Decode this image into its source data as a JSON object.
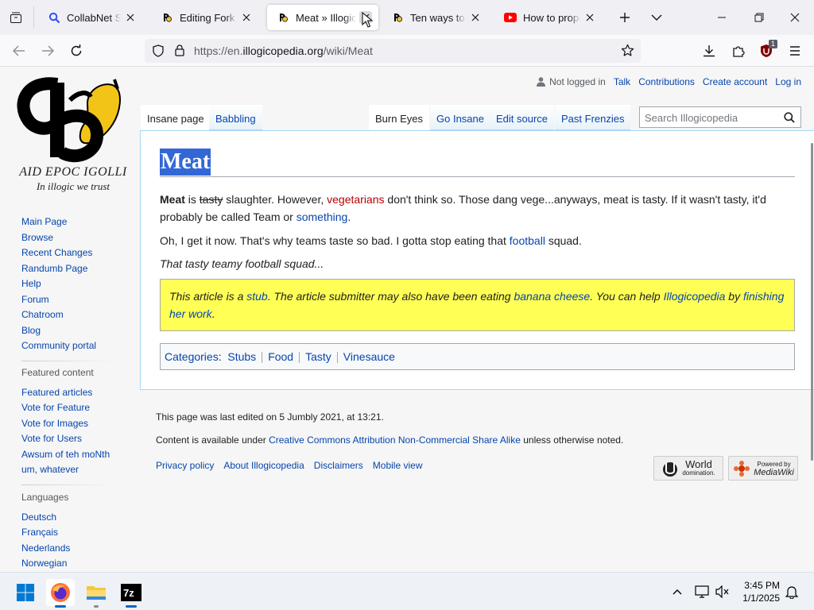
{
  "browser": {
    "tabs": [
      {
        "title": "CollabNet SearX",
        "favicon": "search-icon"
      },
      {
        "title": "Editing Fork » Illogicopedia",
        "favicon": "illogicopedia-icon"
      },
      {
        "title": "Meat » Illogicopedia",
        "favicon": "illogicopedia-icon",
        "active": true
      },
      {
        "title": "Ten ways to kill",
        "favicon": "illogicopedia-icon"
      },
      {
        "title": "How to properly",
        "favicon": "youtube-icon"
      }
    ],
    "url_prefix": "https://en.",
    "url_domain": "illogicopedia.org",
    "url_path": "/wiki/Meat",
    "extension_badge": "1"
  },
  "wiki": {
    "logo_text": "AID EPOC IGOLLI",
    "logo_tagline": "In illogic we trust",
    "personal": {
      "not_logged_in": "Not logged in",
      "talk": "Talk",
      "contributions": "Contributions",
      "create_account": "Create account",
      "log_in": "Log in"
    },
    "tabs": {
      "page": "Insane page",
      "discussion": "Babbling",
      "read": "Burn Eyes",
      "edit": "Go Insane",
      "edit_source": "Edit source",
      "history": "Past Frenzies"
    },
    "search_placeholder": "Search Illogicopedia",
    "nav": [
      "Main Page",
      "Browse",
      "Recent Changes",
      "Randumb Page",
      "Help",
      "Forum",
      "Chatroom",
      "Blog",
      "Community portal"
    ],
    "featured_heading": "Featured content",
    "featured": [
      "Featured articles",
      "Vote for Feature",
      "Vote for Images",
      "Vote for Users",
      "Awsum of teh moNth",
      "um, whatever"
    ],
    "languages_heading": "Languages",
    "languages": [
      "Deutsch",
      "Français",
      "Nederlands",
      "Norwegian"
    ],
    "heading": "Meat",
    "p1": {
      "bold": "Meat",
      "is": " is ",
      "struck": "tasty",
      "t1": " slaughter. However, ",
      "link1": "vegetarians",
      "t2": " don't think so. Those dang vege...anyways, meat is tasty. If it wasn't tasty, it'd probably be called Team or ",
      "link2": "something",
      "t3": "."
    },
    "p2": {
      "t1": "Oh, I get it now. That's why teams taste so bad. I gotta stop eating that ",
      "link": "football",
      "t2": " squad."
    },
    "p3": "That tasty teamy football squad...",
    "stub": {
      "t1": "This article is a ",
      "link1": "stub",
      "t2": ". The article submitter may also have been eating ",
      "link2": "banana cheese",
      "t3": ". You can help ",
      "link3": "Illogicopedia",
      "t4": " by ",
      "link4": "finishing her work",
      "t5": "."
    },
    "categories_label": "Categories",
    "categories": [
      "Stubs",
      "Food",
      "Tasty",
      "Vinesauce"
    ],
    "footer": {
      "last_edited": "This page was last edited on 5 Jumbly 2021, at 13:21.",
      "license_pre": "Content is available under ",
      "license_link": "Creative Commons Attribution Non-Commercial Share Alike",
      "license_post": " unless otherwise noted.",
      "links": [
        "Privacy policy",
        "About Illogicopedia",
        "Disclaimers",
        "Mobile view"
      ],
      "badge1_line1": "World",
      "badge1_line2": "domination.",
      "badge2_line1": "Powered by",
      "badge2_line2": "MediaWiki"
    }
  },
  "taskbar": {
    "apps": [
      "windows-start-icon",
      "firefox-icon",
      "file-explorer-icon",
      "7zip-icon"
    ],
    "time": "3:45 PM",
    "date": "1/1/2025"
  }
}
